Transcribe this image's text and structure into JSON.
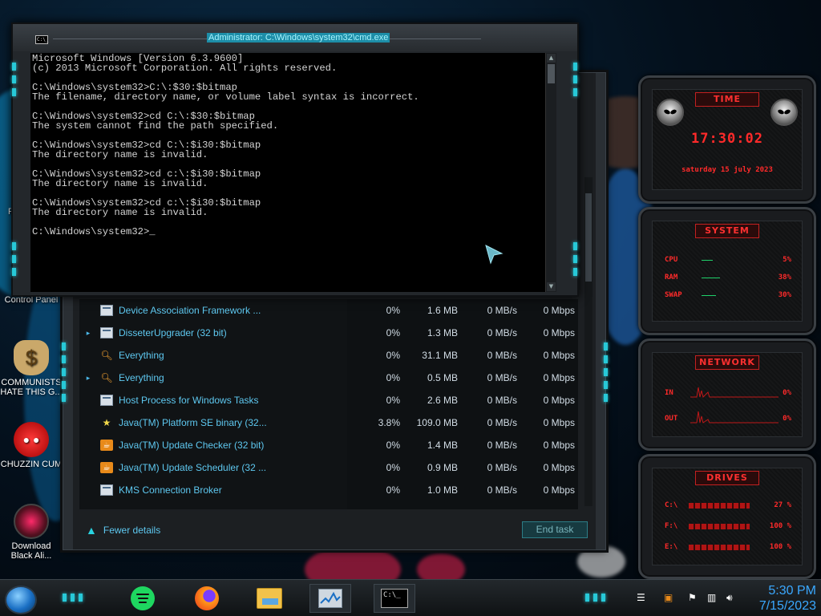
{
  "desktop": {
    "icons": [
      {
        "label": "Control Panel"
      },
      {
        "label": "COMMUNISTS HATE THIS G..."
      },
      {
        "label": "CHUZZIN CUM"
      },
      {
        "label": "Download Black Ali..."
      }
    ],
    "partial_label": "Re"
  },
  "cmd": {
    "title": "Administrator: C:\\Windows\\system32\\cmd.exe",
    "icon_text": "C:\\",
    "lines": [
      "Microsoft Windows [Version 6.3.9600]",
      "(c) 2013 Microsoft Corporation. All rights reserved.",
      "",
      "C:\\Windows\\system32>C:\\:$30:$bitmap",
      "The filename, directory name, or volume label syntax is incorrect.",
      "",
      "C:\\Windows\\system32>cd C:\\:$30:$bitmap",
      "The system cannot find the path specified.",
      "",
      "C:\\Windows\\system32>cd C:\\:$i30:$bitmap",
      "The directory name is invalid.",
      "",
      "C:\\Windows\\system32>cd c:\\:$i30:$bitmap",
      "The directory name is invalid.",
      "",
      "C:\\Windows\\system32>cd c:\\:$i30:$bitmap",
      "The directory name is invalid.",
      "",
      "C:\\Windows\\system32>_"
    ]
  },
  "taskmgr": {
    "side_fragments": [
      "6",
      "<",
      "s",
      "s"
    ],
    "processes": [
      {
        "expand": "",
        "icon": "window-icon",
        "name": "Device Association Framework ...",
        "cpu": "0%",
        "memory": "1.6 MB",
        "disk": "0 MB/s",
        "network": "0 Mbps"
      },
      {
        "expand": "▸",
        "icon": "window-icon",
        "name": "DisseterUpgrader (32 bit)",
        "cpu": "0%",
        "memory": "1.3 MB",
        "disk": "0 MB/s",
        "network": "0 Mbps"
      },
      {
        "expand": "",
        "icon": "magnifier-icon",
        "name": "Everything",
        "cpu": "0%",
        "memory": "31.1 MB",
        "disk": "0 MB/s",
        "network": "0 Mbps"
      },
      {
        "expand": "▸",
        "icon": "magnifier-icon",
        "name": "Everything",
        "cpu": "0%",
        "memory": "0.5 MB",
        "disk": "0 MB/s",
        "network": "0 Mbps"
      },
      {
        "expand": "",
        "icon": "window-icon",
        "name": "Host Process for Windows Tasks",
        "cpu": "0%",
        "memory": "2.6 MB",
        "disk": "0 MB/s",
        "network": "0 Mbps"
      },
      {
        "expand": "",
        "icon": "star-icon",
        "name": "Java(TM) Platform SE binary (32...",
        "cpu": "3.8%",
        "memory": "109.0 MB",
        "disk": "0 MB/s",
        "network": "0 Mbps"
      },
      {
        "expand": "",
        "icon": "java-icon",
        "name": "Java(TM) Update Checker (32 bit)",
        "cpu": "0%",
        "memory": "1.4 MB",
        "disk": "0 MB/s",
        "network": "0 Mbps"
      },
      {
        "expand": "",
        "icon": "java-icon",
        "name": "Java(TM) Update Scheduler (32 ...",
        "cpu": "0%",
        "memory": "0.9 MB",
        "disk": "0 MB/s",
        "network": "0 Mbps"
      },
      {
        "expand": "",
        "icon": "window-icon",
        "name": "KMS Connection Broker",
        "cpu": "0%",
        "memory": "1.0 MB",
        "disk": "0 MB/s",
        "network": "0 Mbps"
      }
    ],
    "fewer_details": "Fewer details",
    "end_task": "End task"
  },
  "gadgets": {
    "time": {
      "title": "TIME",
      "clock": "17:30:02",
      "date": "saturday 15 july 2023"
    },
    "system": {
      "title": "SYSTEM",
      "rows": [
        {
          "label": "CPU",
          "value": "5%",
          "level": 0.05
        },
        {
          "label": "RAM",
          "value": "38%",
          "level": 0.38
        },
        {
          "label": "SWAP",
          "value": "30%",
          "level": 0.3
        }
      ]
    },
    "network": {
      "title": "NETWORK",
      "rows": [
        {
          "label": "IN",
          "value": "0%"
        },
        {
          "label": "OUT",
          "value": "0%"
        }
      ]
    },
    "drives": {
      "title": "DRIVES",
      "rows": [
        {
          "label": "C:\\",
          "value": "27 %"
        },
        {
          "label": "F:\\",
          "value": "100 %"
        },
        {
          "label": "E:\\",
          "value": "100 %"
        }
      ]
    }
  },
  "taskbar": {
    "pinned": [
      {
        "icon": "spotify-icon"
      },
      {
        "icon": "firefox-icon"
      },
      {
        "icon": "file-explorer-icon"
      },
      {
        "icon": "task-manager-icon"
      },
      {
        "icon": "command-prompt-icon",
        "text": "C:\\_"
      }
    ],
    "clock_time": "5:30 PM",
    "clock_date": "7/15/2023"
  },
  "colors": {
    "accent_cyan": "#27c9d8",
    "gadget_red": "#ff2a2a",
    "process_text": "#5ec8f0",
    "clock_blue": "#3aa8ff"
  }
}
